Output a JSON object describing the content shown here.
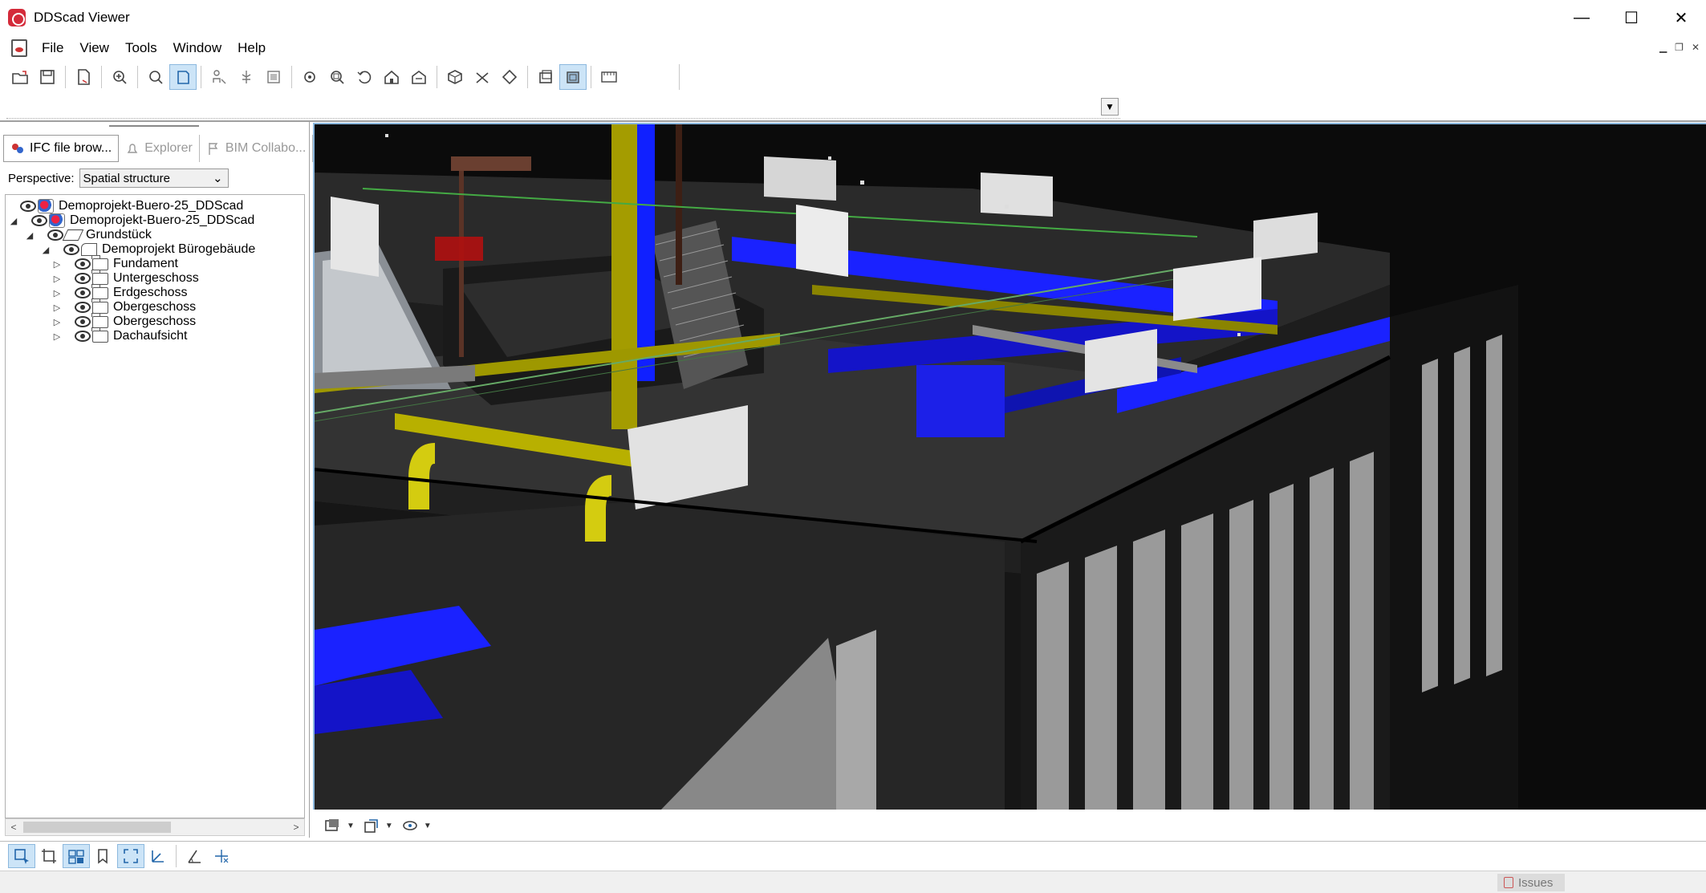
{
  "window": {
    "title": "DDScad Viewer",
    "minimize": "—",
    "maximize": "☐",
    "close": "✕"
  },
  "menu": [
    "File",
    "View",
    "Tools",
    "Window",
    "Help"
  ],
  "left_panel": {
    "tabs": [
      {
        "label": "IFC file brow...",
        "active": true
      },
      {
        "label": "Explorer",
        "active": false
      },
      {
        "label": "BIM Collabo...",
        "active": false
      }
    ],
    "perspective_label": "Perspective:",
    "perspective_value": "Spatial structure",
    "tree": [
      {
        "label": "Demoprojekt-Buero-25_DDScad",
        "level": 0,
        "icon": "project",
        "expander": ""
      },
      {
        "label": "Demoprojekt-Buero-25_DDScad",
        "level": 1,
        "icon": "project",
        "expander": "◢"
      },
      {
        "label": "Grundstück",
        "level": 2,
        "icon": "site",
        "expander": "◢"
      },
      {
        "label": "Demoprojekt Bürogebäude",
        "level": 3,
        "icon": "building",
        "expander": "◢"
      },
      {
        "label": "Fundament",
        "level": 4,
        "icon": "folder",
        "expander": "▷"
      },
      {
        "label": "Untergeschoss",
        "level": 4,
        "icon": "folder",
        "expander": "▷"
      },
      {
        "label": "Erdgeschoss",
        "level": 4,
        "icon": "folder",
        "expander": "▷"
      },
      {
        "label": "Obergeschoss",
        "level": 4,
        "icon": "folder",
        "expander": "▷"
      },
      {
        "label": "Obergeschoss",
        "level": 4,
        "icon": "folder",
        "expander": "▷"
      },
      {
        "label": "Dachaufsicht",
        "level": 4,
        "icon": "folder",
        "expander": "▷"
      }
    ]
  },
  "status": {
    "issues_label": "Issues"
  },
  "colors": {
    "accent": "#cce4f7",
    "viewport_bg": "#0b0b0b",
    "duct_blue": "#1a22ff",
    "pipe_yellow": "#c8c000"
  }
}
